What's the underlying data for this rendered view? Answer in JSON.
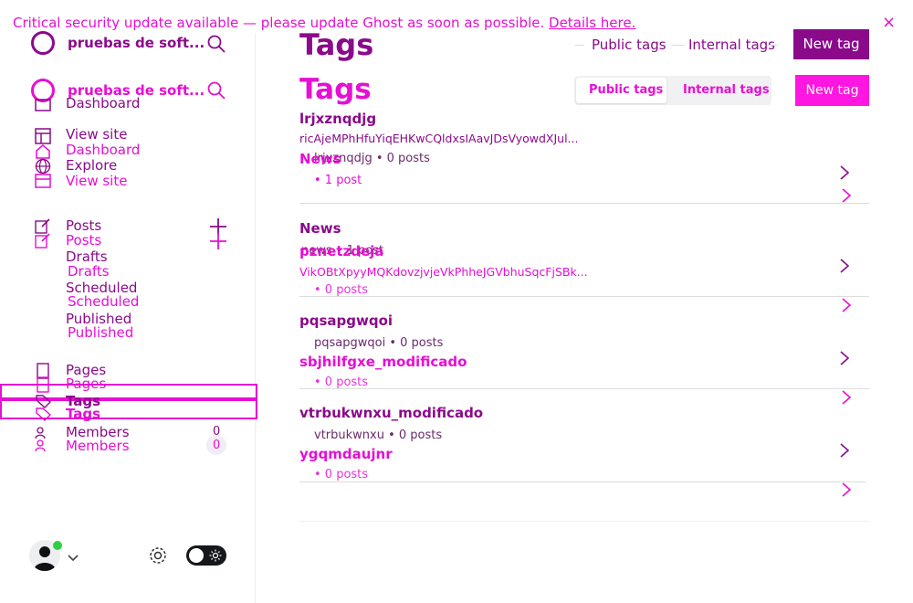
{
  "banner": {
    "text": "Critical security update available — please update Ghost as soon as possible.",
    "link": "Details here.",
    "close_glyph": "×"
  },
  "site": {
    "name": "pruebas de soft...",
    "name_overlay": "pruebas de soft..."
  },
  "nav": {
    "dashboard": "Dashboard",
    "view_site": "View site",
    "dashboard_2": "Dashboard",
    "explore": "Explore",
    "view_site_2": "View site",
    "posts": "Posts",
    "posts_2": "Posts",
    "drafts": "Drafts",
    "drafts_2": "Drafts",
    "scheduled": "Scheduled",
    "scheduled_2": "Scheduled",
    "published": "Published",
    "published_2": "Published",
    "pages": "Pages",
    "pages_2": "Pages",
    "tags": "Tags",
    "tags_2": "Tags",
    "members": "Members",
    "members_2": "Members",
    "members_count": "0",
    "members_count_2": "0"
  },
  "header": {
    "title": "Tags",
    "title_overlay": "Tags",
    "tab_public": "Public tags",
    "tab_internal": "Internal tags",
    "tab_public_2": "Public tags",
    "tab_internal_2": "Internal tags",
    "new_tag": "New tag",
    "new_tag_2": "New tag"
  },
  "tags_layer_a": [
    {
      "name": "lrjxznqdjg",
      "description": "ricAjeMPhHfuYiqEHKwCQldxsIAavJDsVyowdXJul...",
      "slug": "lrjxznqdjg",
      "count": "0 posts"
    },
    {
      "name": "News",
      "description": "",
      "slug": "news",
      "count": "1 post"
    },
    {
      "name": "pqsapgwqoi",
      "description": "",
      "slug": "pqsapgwqoi",
      "count": "0 posts"
    },
    {
      "name": "vtrbukwnxu_modificado",
      "description": "",
      "slug": "vtrbukwnxu",
      "count": "0 posts"
    }
  ],
  "tags_layer_b": [
    {
      "name": "News",
      "description": "",
      "meta": "• 1 post"
    },
    {
      "name": "pznetzdeja",
      "description": "VikOBtXpyyMQKdovzjvjeVkPhheJGVbhuSqcFjSBk...",
      "meta": "• 0 posts"
    },
    {
      "name": "sbjhilfgxe_modificado",
      "description": "",
      "meta": "• 0 posts"
    },
    {
      "name": "ygqmdaujnr",
      "description": "",
      "meta": "• 0 posts"
    }
  ],
  "colors": {
    "accent_dark": "#8a0a8a",
    "accent_bright": "#e60fd4",
    "online_dot": "#30cf43"
  }
}
